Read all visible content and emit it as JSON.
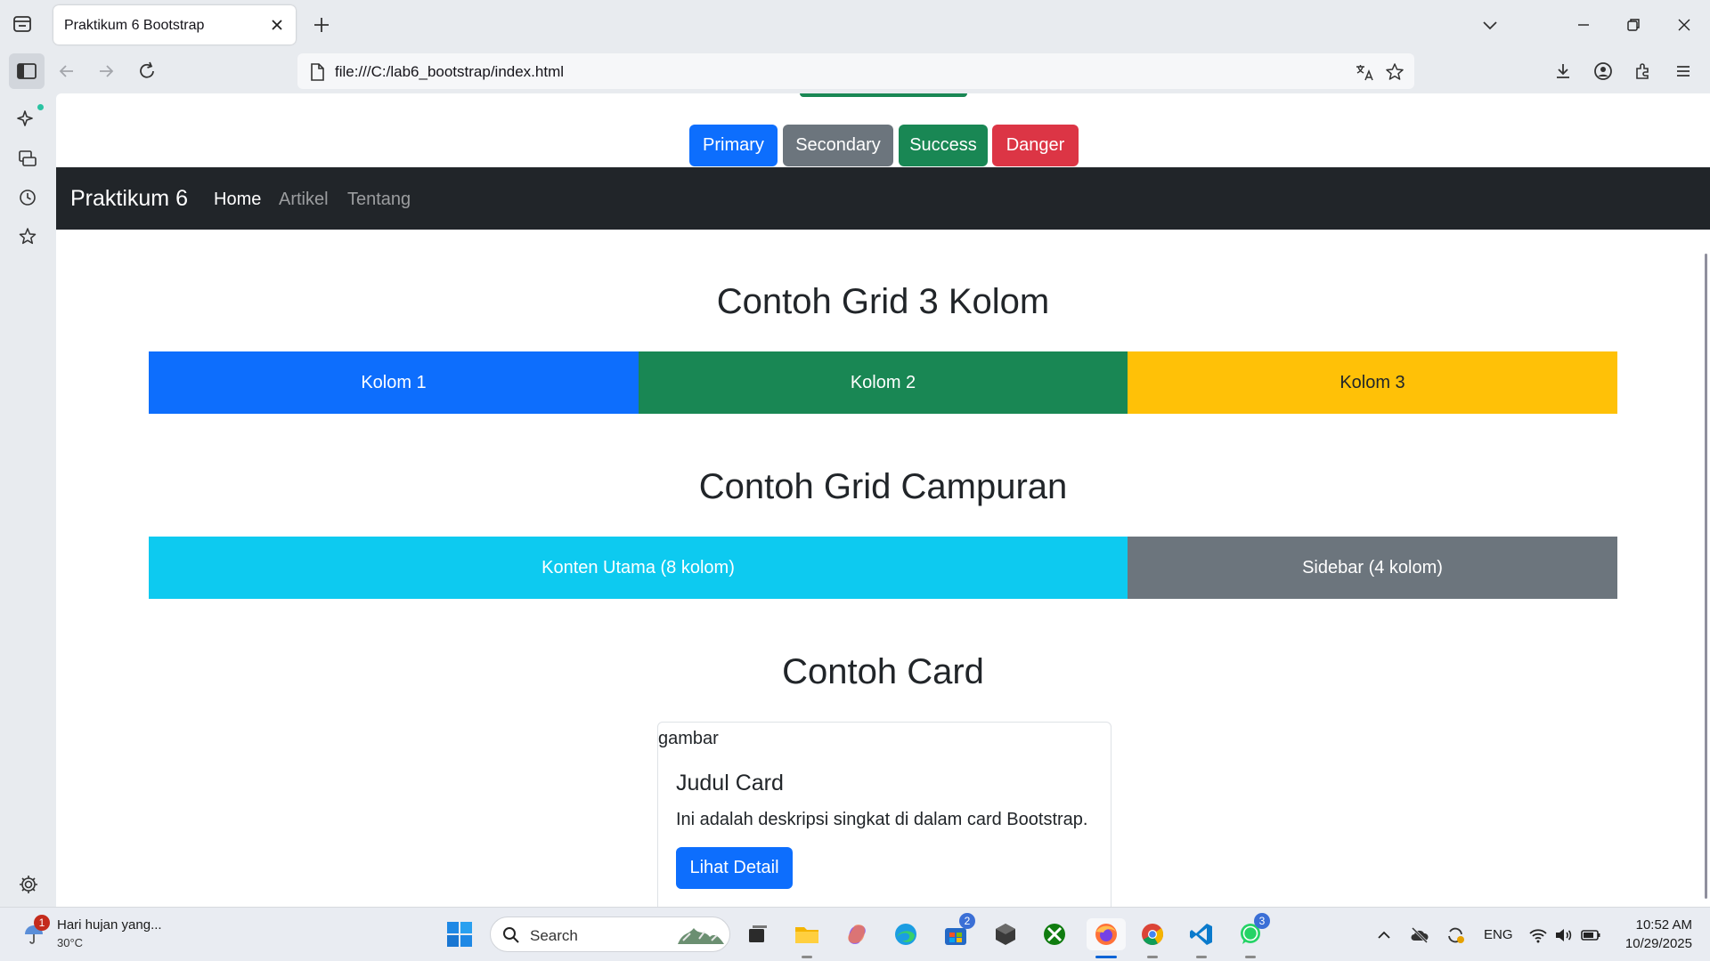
{
  "browser": {
    "tab_title": "Praktikum 6 Bootstrap",
    "url": "file:///C:/lab6_bootstrap/index.html"
  },
  "page": {
    "buttons": [
      {
        "label": "Primary",
        "color": "#0d6efd"
      },
      {
        "label": "Secondary",
        "color": "#6c757d"
      },
      {
        "label": "Success",
        "color": "#198754"
      },
      {
        "label": "Danger",
        "color": "#dc3545"
      }
    ],
    "navbar": {
      "brand": "Praktikum 6",
      "links": [
        "Home",
        "Artikel",
        "Tentang"
      ],
      "active_link": "Home",
      "background": "#212529"
    },
    "grid3": {
      "title": "Contoh Grid 3 Kolom",
      "columns": [
        {
          "label": "Kolom 1",
          "color": "#0d6efd"
        },
        {
          "label": "Kolom 2",
          "color": "#198754"
        },
        {
          "label": "Kolom 3",
          "color": "#ffc107"
        }
      ]
    },
    "grid_mixed": {
      "title": "Contoh Grid Campuran",
      "main": {
        "label": "Konten Utama (8 kolom)",
        "color": "#0dcaf0"
      },
      "sidebar": {
        "label": "Sidebar (4 kolom)",
        "color": "#6c757d"
      }
    },
    "card_section": {
      "title": "Contoh Card",
      "image_alt": "gambar",
      "card_title": "Judul Card",
      "card_text": "Ini adalah deskripsi singkat di dalam card Bootstrap.",
      "button_label": "Lihat Detail"
    }
  },
  "taskbar": {
    "weather_text": "Hari hujan yang...",
    "weather_temp": "30°C",
    "weather_badge": "1",
    "search_label": "Search",
    "store_badge": "2",
    "whatsapp_badge": "3",
    "language": "ENG",
    "time": "10:52 AM",
    "date": "10/29/2025"
  }
}
